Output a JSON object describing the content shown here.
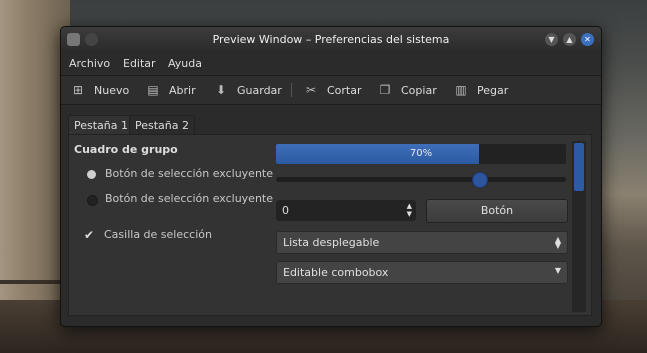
{
  "window": {
    "title": "Preview Window – Preferencias del sistema"
  },
  "menu": [
    "Archivo",
    "Editar",
    "Ayuda"
  ],
  "toolbar": [
    {
      "label": "Nuevo",
      "icon": "new-icon"
    },
    {
      "label": "Abrir",
      "icon": "open-icon"
    },
    {
      "label": "Guardar",
      "icon": "save-icon"
    },
    {
      "label": "Cortar",
      "icon": "cut-icon"
    },
    {
      "label": "Copiar",
      "icon": "copy-icon"
    },
    {
      "label": "Pegar",
      "icon": "paste-icon"
    }
  ],
  "tabs": [
    "Pestaña 1",
    "Pestaña 2"
  ],
  "group": {
    "title": "Cuadro de grupo",
    "radio1": "Botón de selección excluyente",
    "radio2": "Botón de selección excluyente",
    "checkbox": "Casilla de selección"
  },
  "progress": {
    "value": 0.7,
    "text": "70%"
  },
  "slider": {
    "value": 0.7
  },
  "spinbox": {
    "value": "0"
  },
  "button": {
    "label": "Botón"
  },
  "combo1": {
    "value": "Lista desplegable"
  },
  "combo2": {
    "value": "Editable combobox"
  },
  "colors": {
    "accent": "#2c5aa3",
    "window_bg": "#2b2b2b"
  }
}
